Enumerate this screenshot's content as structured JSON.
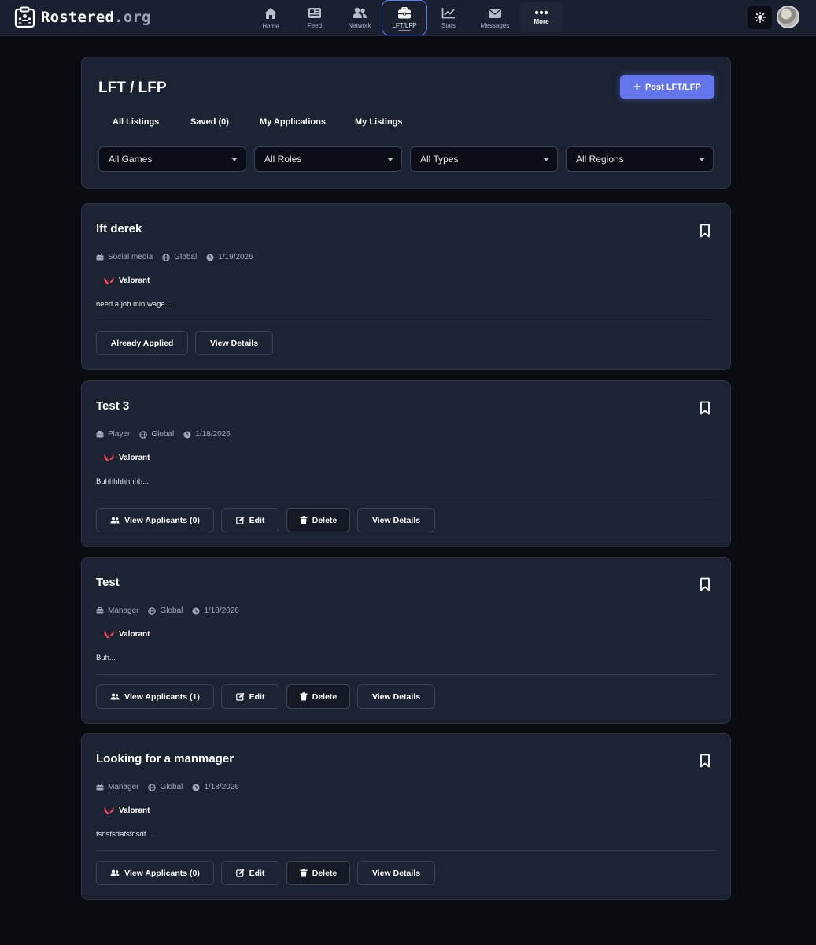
{
  "header": {
    "brand_main": "Rostered",
    "brand_tld": ".org",
    "nav": [
      {
        "label": "Home",
        "icon": "home-icon"
      },
      {
        "label": "Feed",
        "icon": "feed-icon"
      },
      {
        "label": "Network",
        "icon": "network-icon"
      },
      {
        "label": "LFT/LFP",
        "icon": "briefcase-icon",
        "active": true
      },
      {
        "label": "Stats",
        "icon": "chart-line-icon"
      },
      {
        "label": "Messages",
        "icon": "envelope-icon"
      },
      {
        "label": "More",
        "icon": "ellipsis-icon"
      }
    ],
    "theme_icon": "sun-icon"
  },
  "page": {
    "title": "LFT / LFP",
    "post_button": "Post LFT/LFP",
    "tabs": [
      "All Listings",
      "Saved (0)",
      "My Applications",
      "My Listings"
    ],
    "filters": [
      "All Games",
      "All Roles",
      "All Types",
      "All Regions"
    ]
  },
  "colors": {
    "accent": "#6576ec",
    "valorant": "#ff4655",
    "background": "#0a0c11",
    "card": "#1c2333"
  },
  "listings": [
    {
      "title": "lft derek",
      "role": "Social media",
      "region": "Global",
      "date": "1/19/2026",
      "game": "Valorant",
      "description": "need a job min wage...",
      "own": false,
      "applied_label": "Already Applied",
      "details_label": "View Details"
    },
    {
      "title": "Test 3",
      "role": "Player",
      "region": "Global",
      "date": "1/18/2026",
      "game": "Valorant",
      "description": "Buhhhhhhhhh...",
      "own": true,
      "applicants_label": "View Applicants (0)",
      "edit_label": "Edit",
      "delete_label": "Delete",
      "details_label": "View Details"
    },
    {
      "title": "Test",
      "role": "Manager",
      "region": "Global",
      "date": "1/18/2026",
      "game": "Valorant",
      "description": "Buh...",
      "own": true,
      "applicants_label": "View Applicants (1)",
      "edit_label": "Edit",
      "delete_label": "Delete",
      "details_label": "View Details"
    },
    {
      "title": "Looking for a manmager",
      "role": "Manager",
      "region": "Global",
      "date": "1/18/2026",
      "game": "Valorant",
      "description": "fsdsfsdafsfdsdf...",
      "own": true,
      "applicants_label": "View Applicants (0)",
      "edit_label": "Edit",
      "delete_label": "Delete",
      "details_label": "View Details"
    }
  ]
}
